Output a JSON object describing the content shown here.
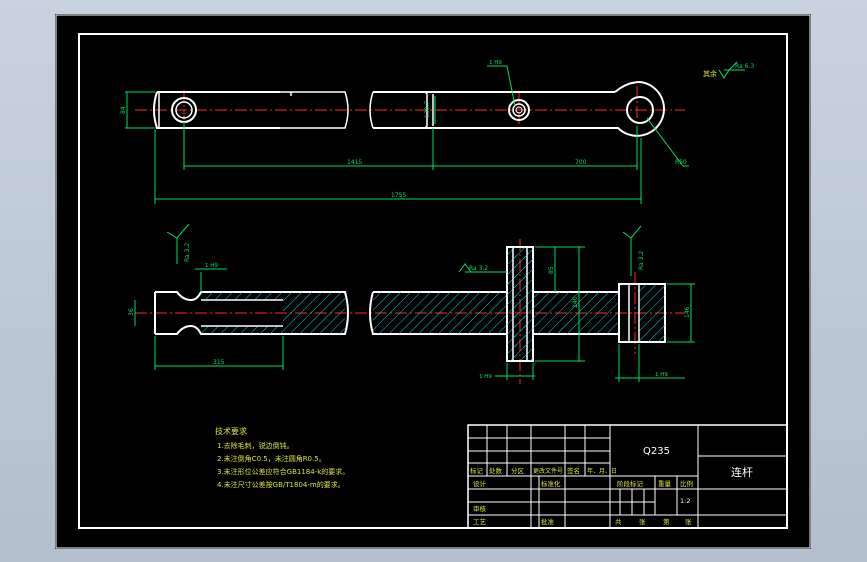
{
  "title_block": {
    "material": "Q235",
    "part_name": "连杆",
    "scale": "1:2",
    "header_cells": [
      "标记",
      "处数",
      "分区",
      "更改文件号",
      "签名",
      "年、月、日"
    ],
    "role_design": "设计",
    "role_standard": "标准化",
    "role_audit": "审核",
    "role_process": "工艺",
    "role_approve": "批准",
    "stage_mark": "阶段标记",
    "weight": "重量",
    "scale_label": "比例",
    "sheet_info": [
      "共",
      "张",
      "第",
      "张"
    ]
  },
  "tech_req": {
    "title": "技术要求",
    "items": [
      "1.去除毛刺，锐边倒钝。",
      "2.未注倒角C0.5，未注圆角R0.5。",
      "3.未注形位公差应符合GB1184-k的要求。",
      "4.未注尺寸公差按GB/T1804-m的要求。"
    ]
  },
  "roughness": {
    "other_label": "其余",
    "other_value": "Ra 6.3",
    "value_32": "Ra 3.2"
  },
  "dims": {
    "d_1415": "1415",
    "d_700": "700",
    "d_1755": "1755",
    "d_r50": "R50",
    "d_h_left": "84",
    "d_phi_hub": "130.7",
    "d_left_len": "315",
    "d_left_h": "36",
    "d_right_h": "146",
    "d_hub_h": "85",
    "d_hub_h2": "240",
    "d_fit1": "1 H9",
    "d_fit2": "1 H9",
    "d_fit3": "1 H9",
    "d_fit4": "1 H9"
  },
  "colors": {
    "outline": "#ffffff",
    "center": "#ff2a2a",
    "dimension": "#00e060",
    "hatch": "#00d8d8",
    "note_text": "#d8e63a"
  }
}
